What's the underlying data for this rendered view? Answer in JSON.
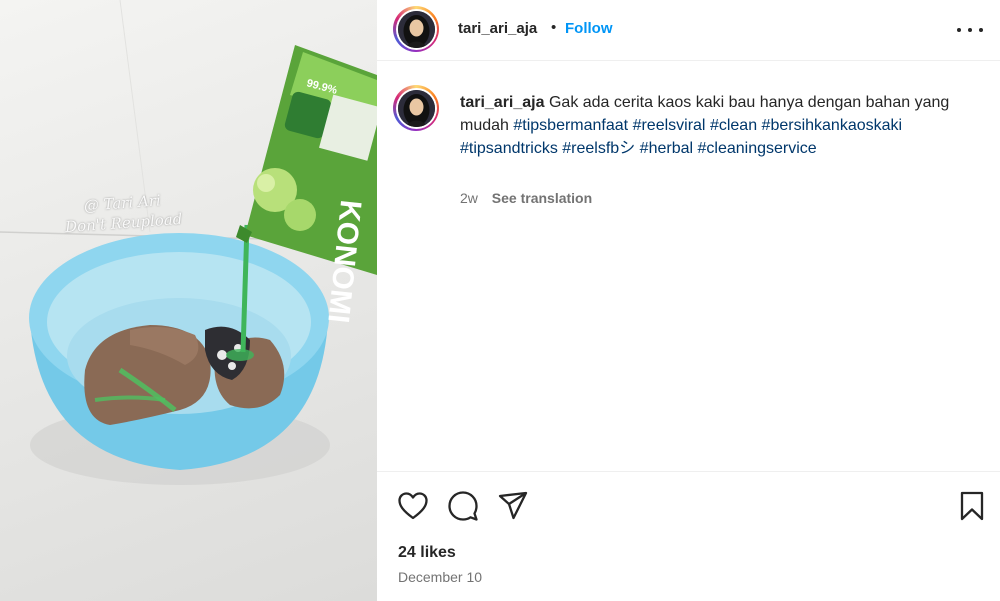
{
  "post": {
    "username": "tari_ari_aja",
    "separator": "•",
    "follow_label": "Follow",
    "more_icon": "more-options-icon"
  },
  "media": {
    "watermark_line1": "@ Tari Ari",
    "watermark_line2": "Don't Reupload",
    "package_text": "99.9%",
    "package_brand": "KONOMI",
    "colors": {
      "basin": "#7fd0ec",
      "liquid": "#3fb55a",
      "package": "#5aa43a"
    }
  },
  "caption": {
    "username": "tari_ari_aja",
    "text": "Gak ada cerita kaos kaki bau hanya dengan bahan yang mudah",
    "hashtags": [
      "#tipsbermanfaat",
      "#reelsviral",
      "#clean",
      "#bersihkankaoskaki",
      "#tipsandtricks",
      "#reelsfbシ",
      "#herbal",
      "#cleaningservice"
    ],
    "age": "2w",
    "see_translation": "See translation"
  },
  "actions": {
    "like_icon": "heart-icon",
    "comment_icon": "comment-icon",
    "share_icon": "share-icon",
    "save_icon": "bookmark-icon",
    "likes": "24 likes",
    "date": "December 10"
  },
  "colors": {
    "accent": "#0095f6",
    "hashtag": "#00376b",
    "muted": "#737373"
  }
}
